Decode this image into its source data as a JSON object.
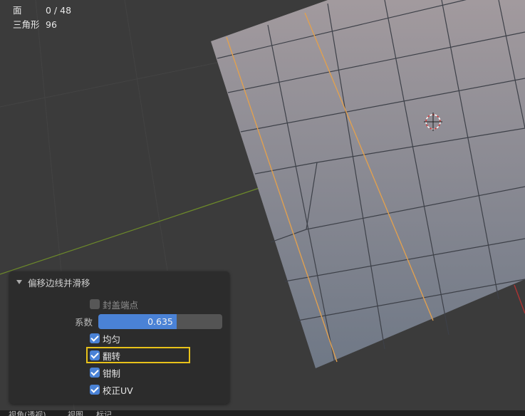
{
  "stats": {
    "faces_label": "面",
    "faces_value": "0 / 48",
    "triangles_label": "三角形",
    "triangles_value": "96"
  },
  "panel": {
    "title": "偏移边线并滑移",
    "cap_endpoint_label": "封盖端点",
    "cap_endpoint_checked": false,
    "factor_label": "系数",
    "factor_value": "0.635",
    "factor_fraction": 0.635,
    "even_label": "均匀",
    "even_checked": true,
    "flip_label": "翻转",
    "flip_checked": true,
    "clamp_label": "钳制",
    "clamp_checked": true,
    "correct_uv_label": "校正UV",
    "correct_uv_checked": true
  },
  "bottom_menu": {
    "items": [
      "视角(透视)",
      "视图",
      "标记"
    ]
  },
  "colors": {
    "accent": "#4a82d6",
    "highlight": "#e8c21a",
    "selected_edge": "#e0a050",
    "panel_bg": "#2c2c2c",
    "viewport_bg": "#3b3b3b"
  }
}
